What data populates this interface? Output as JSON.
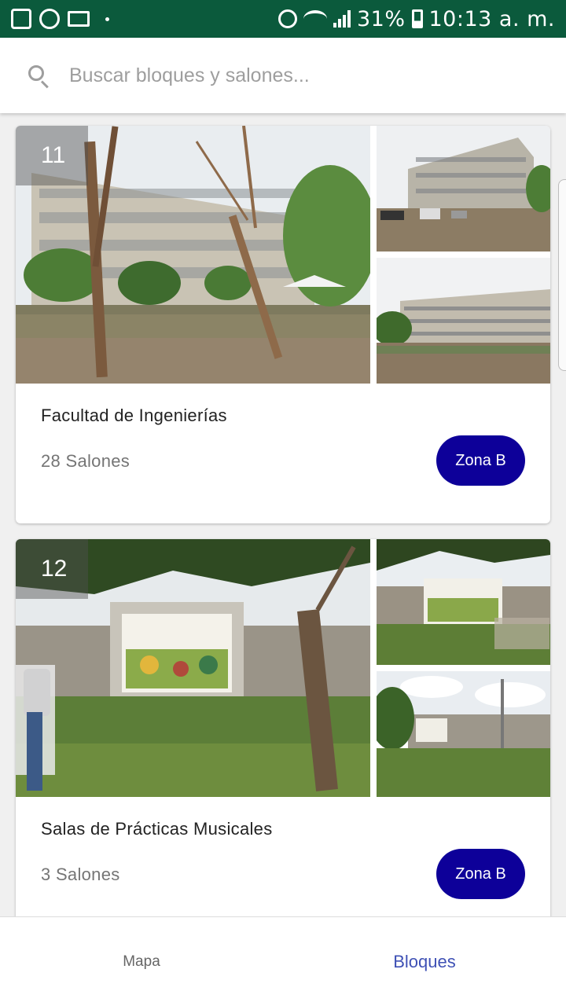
{
  "status_bar": {
    "left_icons": [
      "gallery-icon",
      "whatsapp-icon",
      "laptop-icon",
      "dot-icon"
    ],
    "right_icons": [
      "alarm-icon",
      "wifi-icon",
      "signal-icon",
      "battery-icon"
    ],
    "battery": "31%",
    "time": "10:13 a. m.",
    "background": "#0b5a3c"
  },
  "search": {
    "placeholder": "Buscar bloques y salones...",
    "value": ""
  },
  "cards": [
    {
      "number": "11",
      "title": "Facultad de Ingenierías",
      "count": "28 Salones",
      "zone": "Zona B"
    },
    {
      "number": "12",
      "title": "Salas de Prácticas Musicales",
      "count": "3 Salones",
      "zone": "Zona B"
    }
  ],
  "bottom_nav": {
    "items": [
      {
        "label": "Mapa",
        "active": false
      },
      {
        "label": "Bloques",
        "active": true
      }
    ]
  },
  "colors": {
    "accent": "#3f51b5",
    "zone_button": "#0d0099"
  }
}
